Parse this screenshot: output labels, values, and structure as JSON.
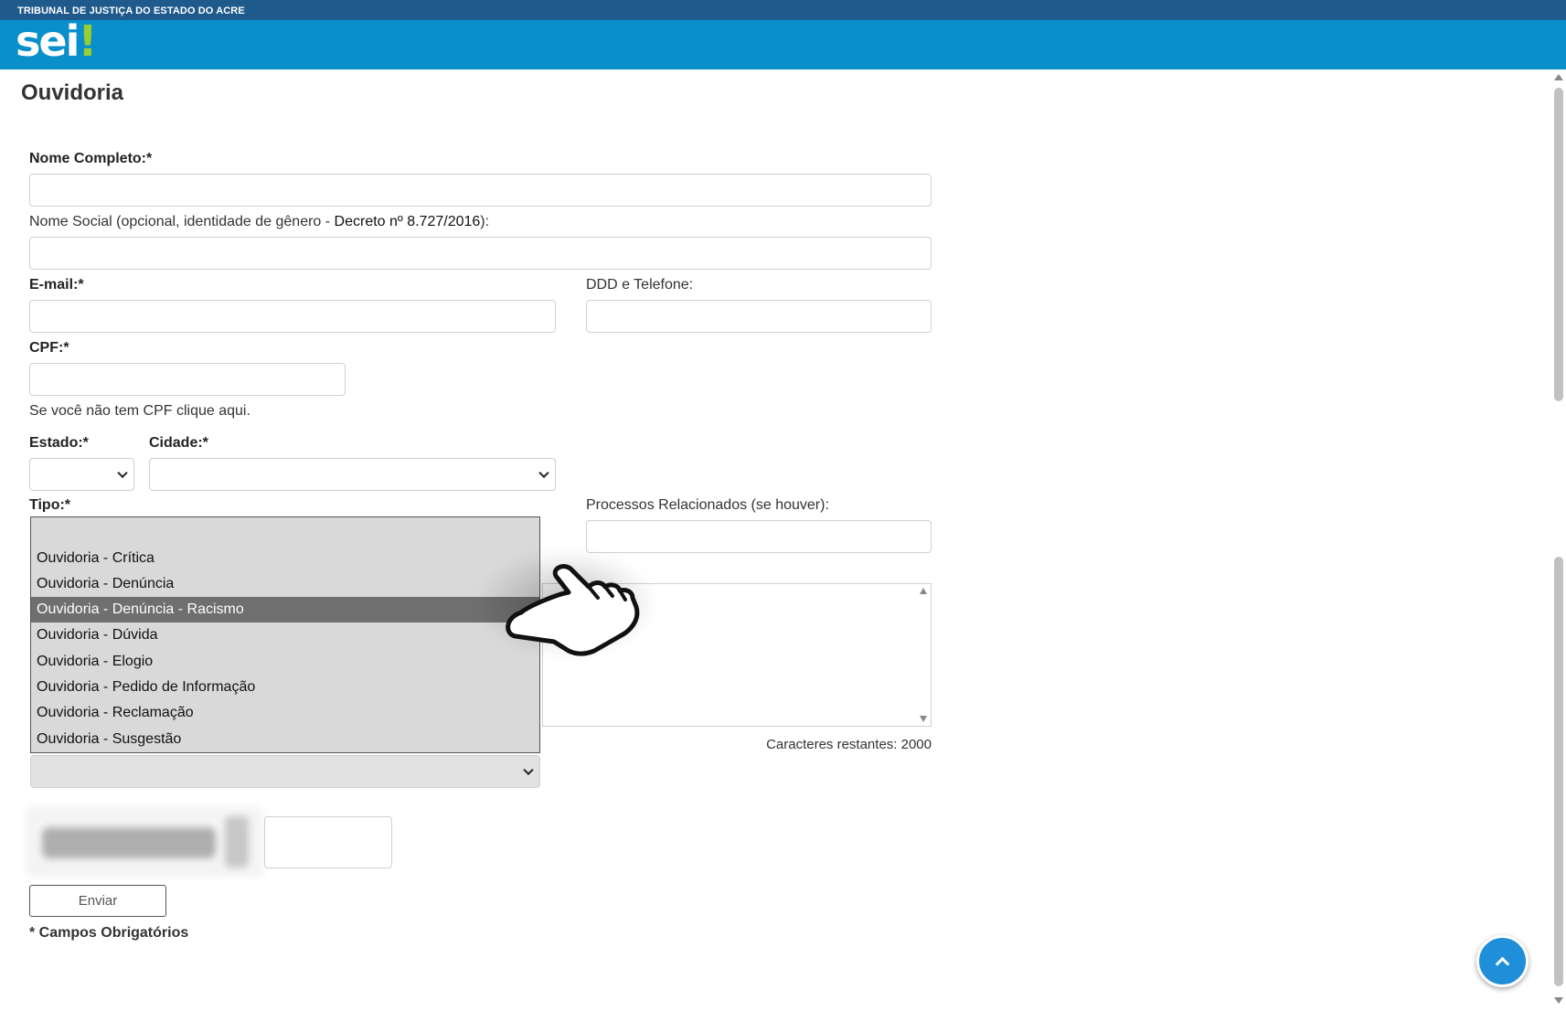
{
  "header": {
    "org_name": "TRIBUNAL DE JUSTIÇA DO ESTADO DO ACRE",
    "logo_text": "sei",
    "logo_mark": "!",
    "colors": {
      "top_bar": "#1f5a8c",
      "main_bar": "#0a8fcb",
      "logo_accent": "#9acd32"
    }
  },
  "page": {
    "title": "Ouvidoria"
  },
  "form": {
    "nome_completo": {
      "label": "Nome Completo:*",
      "value": ""
    },
    "nome_social": {
      "label_prefix": "Nome Social (opcional, identidade de gênero - ",
      "label_decree": "Decreto nº 8.727/2016",
      "label_suffix": "):",
      "value": ""
    },
    "email": {
      "label": "E-mail:*",
      "value": ""
    },
    "telefone": {
      "label": "DDD e Telefone:",
      "value": ""
    },
    "cpf": {
      "label": "CPF:*",
      "value": "",
      "no_cpf_link": "Se você não tem CPF clique aqui."
    },
    "estado": {
      "label": "Estado:*",
      "selected": ""
    },
    "cidade": {
      "label": "Cidade:*",
      "selected": ""
    },
    "tipo": {
      "label": "Tipo:*",
      "selected": "",
      "options": [
        "",
        "Ouvidoria - Crítica",
        "Ouvidoria - Denúncia",
        "Ouvidoria - Denúncia - Racismo",
        "Ouvidoria - Dúvida",
        "Ouvidoria - Elogio",
        "Ouvidoria - Pedido de Informação",
        "Ouvidoria - Reclamação",
        "Ouvidoria - Susgestão"
      ],
      "highlighted_option": "Ouvidoria - Denúncia - Racismo"
    },
    "processos": {
      "label": "Processos Relacionados (se houver):",
      "value": ""
    },
    "mensagem": {
      "value": "",
      "counter": "Caracteres restantes: 2000"
    },
    "captcha": {
      "value": ""
    },
    "submit_label": "Enviar",
    "required_note": "* Campos Obrigatórios"
  },
  "icons": {
    "scroll_top": "chevron-up-icon",
    "pointer": "hand-pointer-icon",
    "dropdown": "chevron-down-icon"
  }
}
